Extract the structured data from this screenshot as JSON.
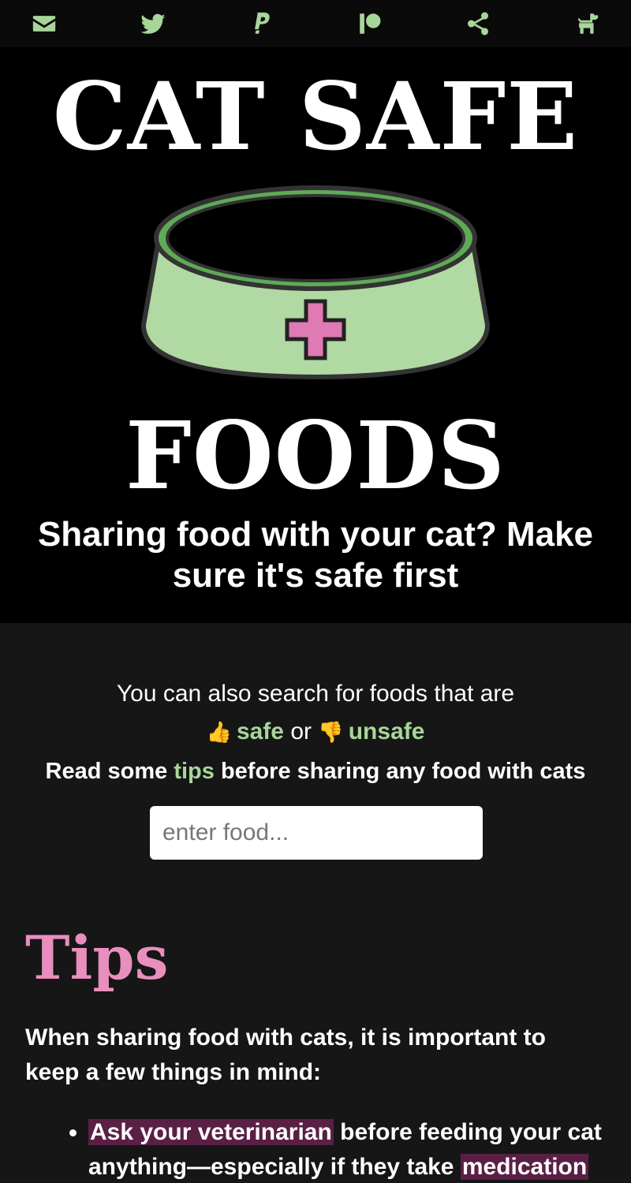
{
  "nav": {
    "icons": [
      "email-icon",
      "twitter-icon",
      "paypal-icon",
      "patreon-icon",
      "share-icon",
      "dog-icon"
    ],
    "accent": "#a7d69a"
  },
  "hero": {
    "title_top": "CAT SAFE",
    "title_bottom": "FOODS",
    "tagline": "Sharing food with your cat? Make sure it's safe first",
    "bowl_color": "#b1d9a3",
    "cross_color": "#e07ab4"
  },
  "search": {
    "intro": "You can also search for foods that are",
    "safe_emoji": "👍",
    "safe_label": "safe",
    "or_label": "or",
    "unsafe_emoji": "👎",
    "unsafe_label": "unsafe",
    "tips_prefix": "Read some",
    "tips_link": "tips",
    "tips_suffix": "before sharing any food with cats",
    "placeholder": "enter food..."
  },
  "tips": {
    "heading": "Tips",
    "intro": "When sharing food with cats, it is important to keep a few things in mind:",
    "item1_highlight": "Ask your veterinarian",
    "item1_text": "before feeding your cat anything—especially if they take",
    "item1_highlight2": "medication",
    "heading_color": "#e88fbd",
    "highlight_color": "#5a1f44"
  }
}
